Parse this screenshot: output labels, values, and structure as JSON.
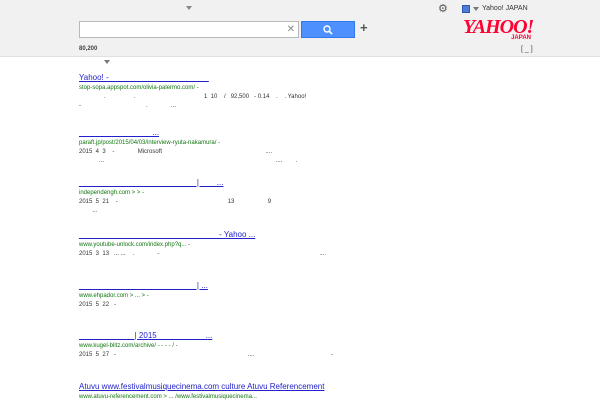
{
  "header": {
    "user_label": "Yahoo! JAPAN",
    "search_value": "",
    "result_count": "80,200",
    "bracket_label": "[ _ ]",
    "clear_icon": "close-icon",
    "search_icon": "search-icon",
    "settings_icon": "gear-icon",
    "accent_color": "#4d90fe"
  },
  "logo": {
    "main": "YAHOO!",
    "sub": "JAPAN"
  },
  "results": [
    {
      "title": "Yahoo!   -  ______________________",
      "url": "stop-sopa.appspot.com/olivia-palermo.com/  -",
      "lines": [
        "               .                 .                                         1  10    /   92,500   - 0.14    .    . Yahoo!",
        "-                                       .              ..."
      ]
    },
    {
      "title": "________________ ...",
      "url": "paraft.jp/post/2015/04/03/interview-ryuta-nakamura/  -",
      "lines": [
        "2015  4  3    -              Microsoft                                                              ....",
        "            ...                                                                                                       ....        ."
      ]
    },
    {
      "title": "__________________________ |  ___ ...",
      "url": "independengh.com >      >        -",
      "lines": [
        "2015  5  21    -                                                                  13                    9",
        "        ..."
      ]
    },
    {
      "title": "_______________________________ - Yahoo ...",
      "url": "www.youtube-unlock.com/index.php?q...   -",
      "lines": [
        "2015  3  13   ... ...    .              -                                                                                                ...."
      ]
    },
    {
      "title": "__________________________ |    ...",
      "url": "www.ehpador.com > ... >                 -",
      "lines": [
        "2015  5  22   -"
      ]
    },
    {
      "title": "____________ | 2015 __________ ...",
      "url": "www.kugel-blitz.com/archive/        -    - -          -  /  -",
      "lines": [
        "2015  5  27   -                                                                               ....                                              -"
      ]
    },
    {
      "title": "Atuvu www.festivalmusiquecinema.com culture Atuvu Referencement",
      "url": "www.atuvu-referencement.com > ... /www.festivalmusiquecinema...",
      "lines": []
    }
  ]
}
